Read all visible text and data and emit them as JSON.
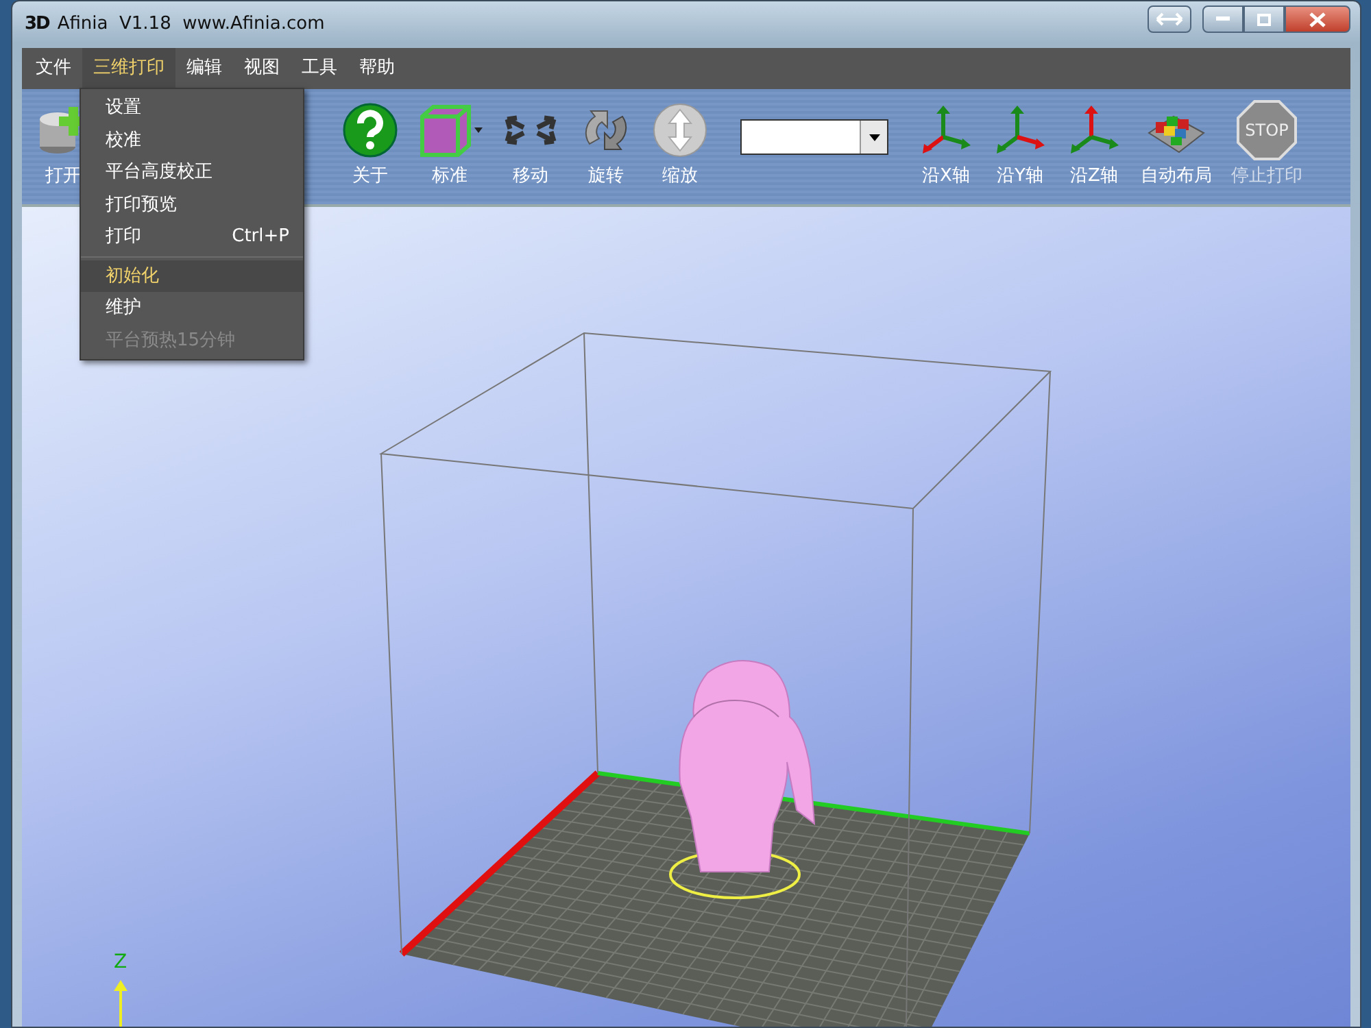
{
  "window": {
    "logo": "3D",
    "title": "Afinia  V1.18  www.Afinia.com"
  },
  "menubar": [
    {
      "label": "文件",
      "selected": false
    },
    {
      "label": "三维打印",
      "selected": true
    },
    {
      "label": "编辑",
      "selected": false
    },
    {
      "label": "视图",
      "selected": false
    },
    {
      "label": "工具",
      "selected": false
    },
    {
      "label": "帮助",
      "selected": false
    }
  ],
  "open_menu": {
    "groups": [
      [
        {
          "label": "设置",
          "selected": false,
          "disabled": false
        },
        {
          "label": "校准",
          "selected": false,
          "disabled": false
        },
        {
          "label": "平台高度校正",
          "selected": false,
          "disabled": false
        },
        {
          "label": "打印预览",
          "selected": false,
          "disabled": false
        },
        {
          "label": "打印",
          "shortcut": "Ctrl+P",
          "selected": false,
          "disabled": false
        }
      ],
      [
        {
          "label": "初始化",
          "selected": true,
          "disabled": false
        },
        {
          "label": "维护",
          "selected": false,
          "disabled": false
        },
        {
          "label": "平台预热15分钟",
          "selected": false,
          "disabled": true
        }
      ]
    ]
  },
  "toolbar": [
    {
      "kind": "button",
      "label": "打开",
      "disabled": false
    },
    {
      "kind": "button",
      "label": "关于",
      "disabled": false
    },
    {
      "kind": "dropdown",
      "label": "标准",
      "disabled": false
    },
    {
      "kind": "button",
      "label": "移动",
      "disabled": false
    },
    {
      "kind": "button",
      "label": "旋转",
      "disabled": false
    },
    {
      "kind": "button",
      "label": "缩放",
      "disabled": false
    },
    {
      "kind": "combo",
      "disabled": false
    },
    {
      "kind": "button",
      "label": "沿X轴",
      "disabled": false
    },
    {
      "kind": "button",
      "label": "沿Y轴",
      "disabled": false
    },
    {
      "kind": "button",
      "label": "沿Z轴",
      "disabled": false
    },
    {
      "kind": "button",
      "label": "自动布局",
      "disabled": false
    },
    {
      "kind": "button",
      "icon_text": "STOP",
      "label": "停止打印",
      "disabled": true
    }
  ],
  "viewport": {
    "axis_label": "Z"
  }
}
